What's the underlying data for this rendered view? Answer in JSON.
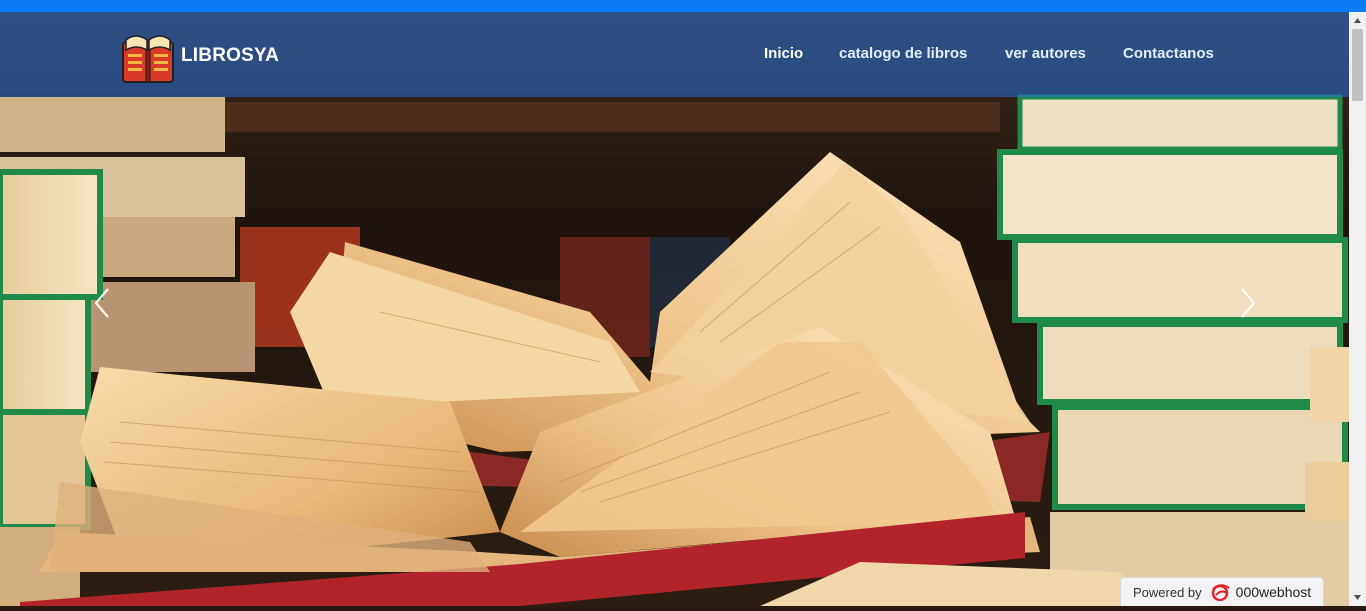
{
  "brand": {
    "name": "LIBROSYA",
    "logo_icon": "open-book-logo-icon"
  },
  "nav": {
    "items": [
      {
        "label": "Inicio",
        "active": true
      },
      {
        "label": "catalogo de libros",
        "active": false
      },
      {
        "label": "ver autores",
        "active": false
      },
      {
        "label": "Contactanos",
        "active": false
      }
    ]
  },
  "carousel": {
    "prev_icon": "chevron-left-icon",
    "next_icon": "chevron-right-icon"
  },
  "badge": {
    "prefix": "Powered by",
    "brand": "000webhost"
  },
  "colors": {
    "top_strip": "#0b7cf6",
    "navbar": "#2670da",
    "book_cover_green": "#1f8a4a",
    "book_cover_red": "#b3202a"
  }
}
